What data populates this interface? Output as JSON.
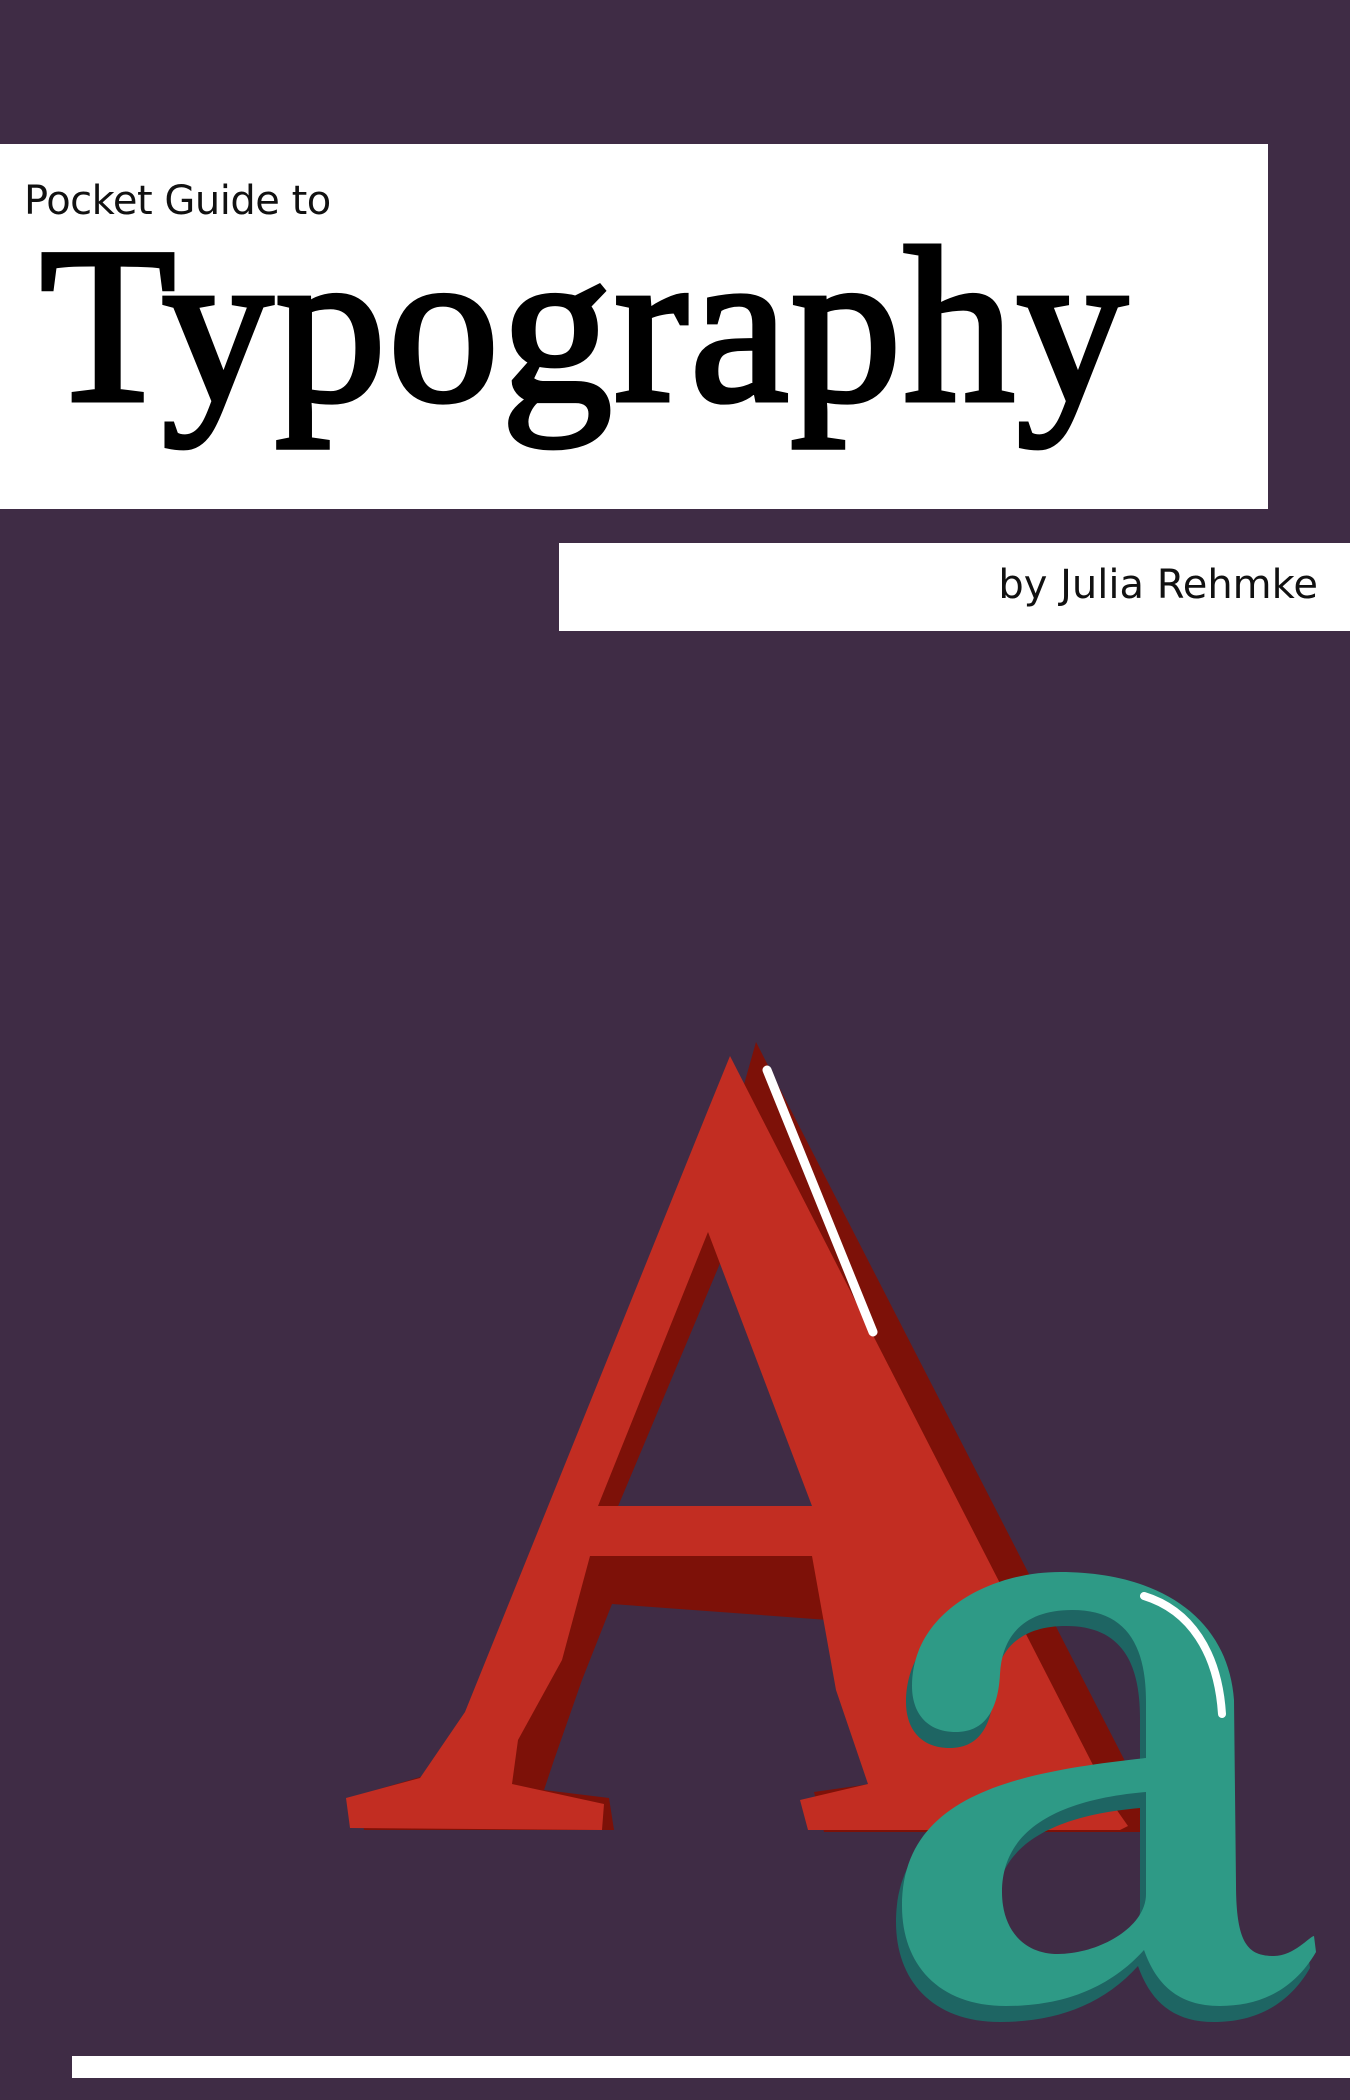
{
  "cover": {
    "subtitle": "Pocket Guide to",
    "title": "Typography",
    "author": "by Julia Rehmke"
  },
  "illustration": {
    "uppercase_letter": "A",
    "lowercase_letter": "a"
  },
  "colors": {
    "background": "#3f2c45",
    "band": "#ffffff",
    "uppercase_fill": "#c22d22",
    "uppercase_shadow": "#7d1108",
    "lowercase_fill": "#2e9a86",
    "lowercase_shadow": "#1e6563",
    "highlight": "#ffffff"
  }
}
